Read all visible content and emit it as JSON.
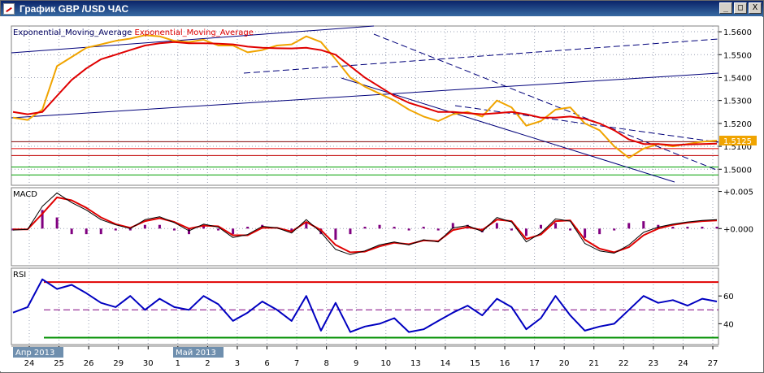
{
  "window": {
    "title": "График GBP /USD  ЧАС",
    "buttons": {
      "minimize": "_",
      "maximize": "□",
      "close": "X"
    }
  },
  "colors": {
    "price": "#f0a400",
    "ema_red": "#e00000",
    "ema_navy": "#000060",
    "channel": "#00007a",
    "macd_signal": "#e00000",
    "macd_line": "#000000",
    "macd_hist": "#800080",
    "rsi": "#0000c0",
    "rsi_upper": "#e00000",
    "rsi_lower": "#009000",
    "rsi_mid": "#800080",
    "price_badge": "#f0a400"
  },
  "chart_data": [
    {
      "type": "line",
      "panel": "price",
      "legend": [
        "Exponential_Moving_Average",
        "Exponential_Moving_Average"
      ],
      "y_ticks": [
        "1.5600",
        "1.5500",
        "1.5400",
        "1.5300",
        "1.5200",
        "1.5100",
        "1.5000"
      ],
      "ylim": [
        1.493,
        1.5625
      ],
      "current_price": "1.5125",
      "x_dates": [
        "24",
        "25",
        "26",
        "29",
        "30",
        "1",
        "2",
        "3",
        "6",
        "7",
        "8",
        "9",
        "10",
        "13",
        "14",
        "15",
        "16",
        "17",
        "20",
        "21",
        "22",
        "23",
        "24",
        "27"
      ],
      "month_labels": [
        "Апр 2013",
        "Май 2013"
      ],
      "series": [
        {
          "values": [
            1.5225,
            1.5215,
            1.526,
            1.545,
            1.549,
            1.553,
            1.5545,
            1.556,
            1.557,
            1.5585,
            1.558,
            1.556,
            1.5555,
            1.5565,
            1.554,
            1.554,
            1.551,
            1.552,
            1.554,
            1.5545,
            1.558,
            1.5555,
            1.548,
            1.54,
            1.536,
            1.533,
            1.53,
            1.526,
            1.523,
            1.521,
            1.524,
            1.525,
            1.523,
            1.53,
            1.527,
            1.519,
            1.521,
            1.526,
            1.527,
            1.52,
            1.517,
            1.51,
            1.505,
            1.509,
            1.511,
            1.51,
            1.511,
            1.512,
            1.5125
          ]
        },
        {
          "values": [
            1.525,
            1.524,
            1.525,
            1.532,
            1.539,
            1.544,
            1.548,
            1.55,
            1.552,
            1.554,
            1.555,
            1.5555,
            1.555,
            1.555,
            1.5548,
            1.5545,
            1.5535,
            1.553,
            1.5528,
            1.5527,
            1.553,
            1.552,
            1.55,
            1.545,
            1.54,
            1.536,
            1.532,
            1.529,
            1.527,
            1.525,
            1.525,
            1.5245,
            1.524,
            1.5245,
            1.525,
            1.524,
            1.5225,
            1.5225,
            1.523,
            1.522,
            1.52,
            1.517,
            1.513,
            1.511,
            1.511,
            1.5105,
            1.5108,
            1.511,
            1.5112
          ]
        }
      ]
    },
    {
      "type": "line",
      "panel": "macd",
      "title": "MACD",
      "y_ticks": [
        "+0.005",
        "+0.000"
      ],
      "ylim": [
        -0.005,
        0.0055
      ],
      "series": [
        {
          "values": [
            -0.0002,
            -0.0001,
            0.003,
            0.0048,
            0.0035,
            0.0025,
            0.0012,
            0.0005,
            0.0,
            0.0012,
            0.0016,
            0.0008,
            -0.0003,
            0.0006,
            0.0002,
            -0.0012,
            -0.0008,
            0.0003,
            0.0001,
            -0.0006,
            0.0012,
            -0.0005,
            -0.0028,
            -0.0035,
            -0.003,
            -0.0022,
            -0.0018,
            -0.0022,
            -0.0015,
            -0.0018,
            0.0001,
            0.0004,
            -0.0004,
            0.0015,
            0.0009,
            -0.0018,
            -0.0006,
            0.0013,
            0.001,
            -0.002,
            -0.003,
            -0.0033,
            -0.0022,
            -0.0005,
            0.0002,
            0.0006,
            0.0009,
            0.0011,
            0.0012
          ]
        },
        {
          "values": [
            -0.0001,
            -0.0001,
            0.002,
            0.0042,
            0.0038,
            0.0028,
            0.0015,
            0.0006,
            0.0001,
            0.001,
            0.0014,
            0.0009,
            0.0,
            0.0004,
            0.0003,
            -0.0009,
            -0.0009,
            0.0001,
            0.0001,
            -0.0004,
            0.0009,
            -0.0002,
            -0.0022,
            -0.0032,
            -0.0031,
            -0.0024,
            -0.0019,
            -0.0021,
            -0.0016,
            -0.0017,
            -0.0002,
            0.0002,
            -0.0002,
            0.0012,
            0.001,
            -0.0014,
            -0.0008,
            0.001,
            0.0011,
            -0.0015,
            -0.0027,
            -0.0032,
            -0.0025,
            -0.0009,
            0.0,
            0.0005,
            0.0008,
            0.001,
            0.0011
          ]
        }
      ]
    },
    {
      "type": "line",
      "panel": "rsi",
      "title": "RSI",
      "y_ticks": [
        "60",
        "40"
      ],
      "ylim": [
        25,
        80
      ],
      "levels": [
        70,
        50,
        30
      ],
      "series": [
        {
          "values": [
            48,
            52,
            72,
            65,
            68,
            62,
            55,
            52,
            60,
            50,
            58,
            52,
            50,
            60,
            54,
            42,
            48,
            56,
            50,
            42,
            60,
            35,
            55,
            34,
            38,
            40,
            44,
            34,
            36,
            42,
            48,
            53,
            46,
            58,
            52,
            36,
            44,
            60,
            46,
            35,
            38,
            40,
            50,
            60,
            55,
            57,
            53,
            58,
            56
          ]
        }
      ]
    }
  ]
}
